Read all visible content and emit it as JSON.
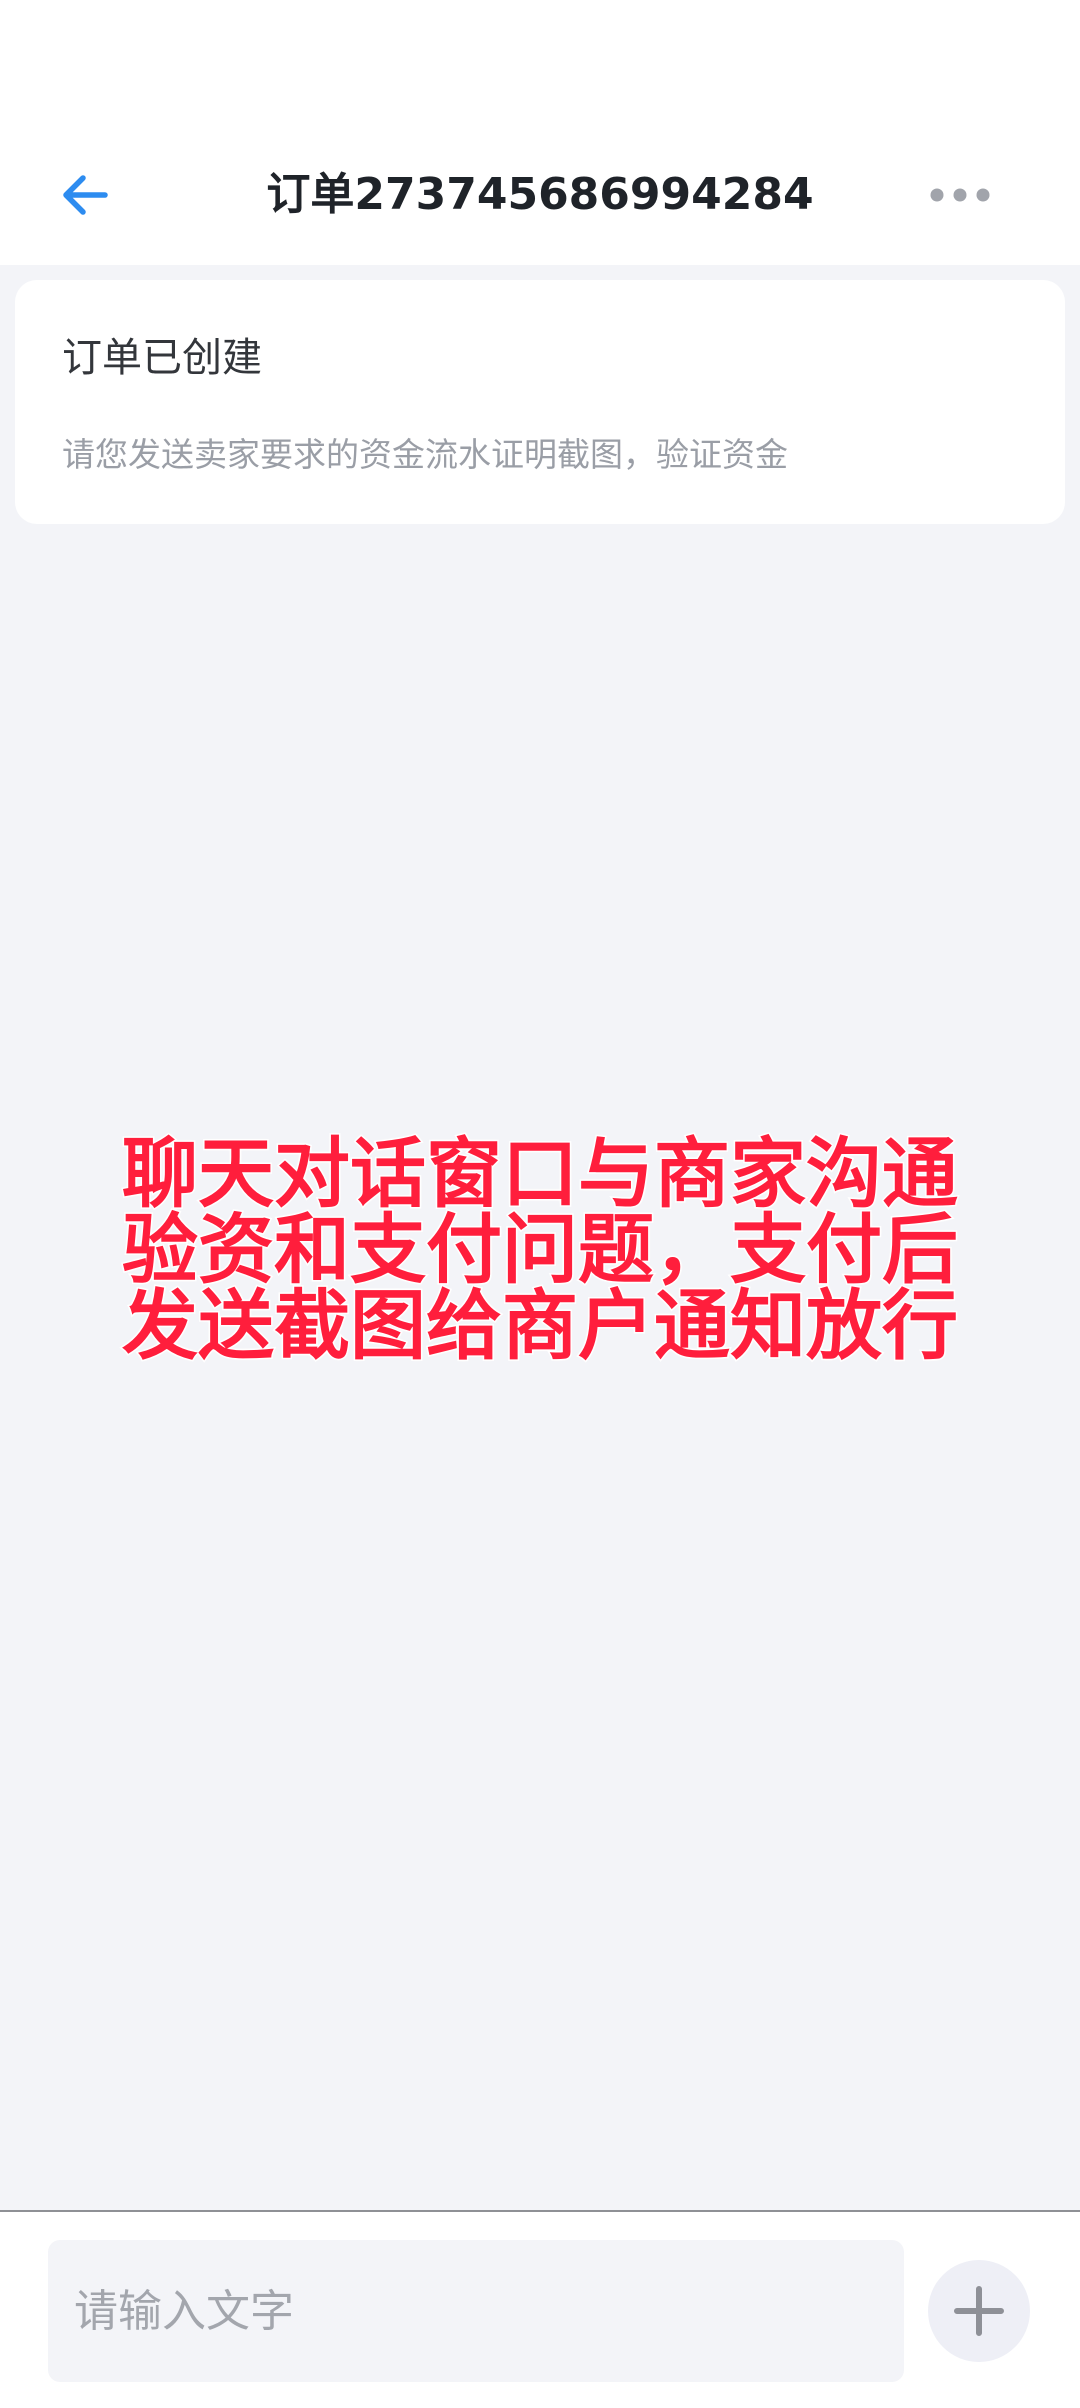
{
  "header": {
    "title": "订单273745686994284",
    "back_icon": "arrow-left-icon",
    "more_icon": "more-horizontal-icon",
    "accent_color": "#2d8cf0"
  },
  "order_card": {
    "title": "订单已创建",
    "description": "请您发送卖家要求的资金流水证明截图，验证资金"
  },
  "overlay_caption": {
    "lines": [
      "聊天对话窗口与商家沟通",
      "验资和支付问题，支付后",
      "发送截图给商户通知放行"
    ],
    "color": "#ff1e3c"
  },
  "composer": {
    "placeholder": "请输入文字",
    "value": "",
    "add_icon": "plus-icon"
  }
}
